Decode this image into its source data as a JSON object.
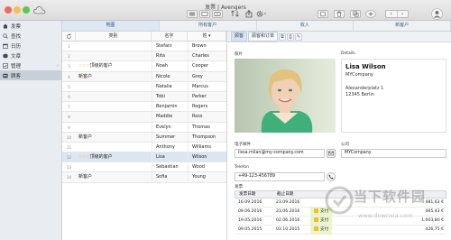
{
  "window": {
    "title": "发票 | Avengers"
  },
  "sidebar": {
    "items": [
      {
        "label": "发票",
        "icon": "home-icon"
      },
      {
        "label": "查找",
        "icon": "search-icon"
      },
      {
        "label": "日历",
        "icon": "calendar-icon"
      },
      {
        "label": "文章",
        "icon": "article-icon"
      },
      {
        "label": "管理",
        "icon": "manage-icon"
      },
      {
        "label": "顾客",
        "icon": "customer-icon"
      }
    ]
  },
  "tabs": [
    "地图",
    "所有客户",
    "收入",
    "新客户"
  ],
  "list": {
    "headers": [
      "类别",
      "名字",
      "姓"
    ],
    "sort_indicator": "▾",
    "rows": [
      {
        "num": "1",
        "category": "",
        "stars": "",
        "first": "Stefani",
        "last": "Brown"
      },
      {
        "num": "2",
        "category": "",
        "stars": "",
        "first": "Rita",
        "last": "Charles"
      },
      {
        "num": "3",
        "category": "顶级的客户",
        "stars": "☆☆☆",
        "first": "Noah",
        "last": "Cooper"
      },
      {
        "num": "4",
        "category": "新客户",
        "stars": "",
        "first": "Nicole",
        "last": "Grey"
      },
      {
        "num": "5",
        "category": "",
        "stars": "",
        "first": "Natalie",
        "last": "Marcus"
      },
      {
        "num": "6",
        "category": "",
        "stars": "",
        "first": "Tobi",
        "last": "Parker"
      },
      {
        "num": "7",
        "category": "",
        "stars": "",
        "first": "Benjamin",
        "last": "Rogers"
      },
      {
        "num": "8",
        "category": "",
        "stars": "",
        "first": "Maddie",
        "last": "Ross"
      },
      {
        "num": "9",
        "category": "",
        "stars": "",
        "first": "Evelyn",
        "last": "Thomas"
      },
      {
        "num": "10",
        "category": "新客户",
        "stars": "",
        "first": "Summer",
        "last": "Thompson"
      },
      {
        "num": "11",
        "category": "",
        "stars": "",
        "first": "Anthony",
        "last": "Williams"
      },
      {
        "num": "12",
        "category": "顶级的客户",
        "stars": "☆☆☆",
        "first": "Lisa",
        "last": "Wilson"
      },
      {
        "num": "13",
        "category": "",
        "stars": "",
        "first": "Sebastian",
        "last": "Wood"
      },
      {
        "num": "14",
        "category": "新客户",
        "stars": "",
        "first": "Sofia",
        "last": "Young"
      }
    ]
  },
  "detail": {
    "subtabs": [
      "顾客",
      "顾客和订单"
    ],
    "photo_label": "照片",
    "details_label": "Details",
    "name": "Lisa Wilson",
    "company": "MYCompany",
    "street": "Alexanderplatz 1",
    "city": "12345 Berlin",
    "email_label": "电子邮件",
    "email": "lissa.milan@my-company.com",
    "company_label": "公司",
    "company_value": "MYCompany",
    "telefon_label": "Telefon",
    "telefon": "+49-123-456789",
    "invoices_label": "发票",
    "invoice_headers": [
      "发票日期",
      "截止日期",
      "",
      ""
    ],
    "invoices": [
      {
        "date": "16.09.2016",
        "due": "23.09.2016",
        "status": "",
        "amount": "481,63 €"
      },
      {
        "date": "09.06.2016",
        "due": "23.06.2016",
        "status": "支付",
        "amount": "465,43 €"
      },
      {
        "date": "19.05.2016",
        "due": "02.06.2016",
        "status": "支付",
        "amount": "1.003,80 €"
      },
      {
        "date": "09.05.2015",
        "due": "03.10.2015",
        "status": "支付",
        "amount": "426,75 €"
      }
    ]
  },
  "watermark": {
    "text": "当下软件园",
    "url": "www.downxia.com"
  }
}
